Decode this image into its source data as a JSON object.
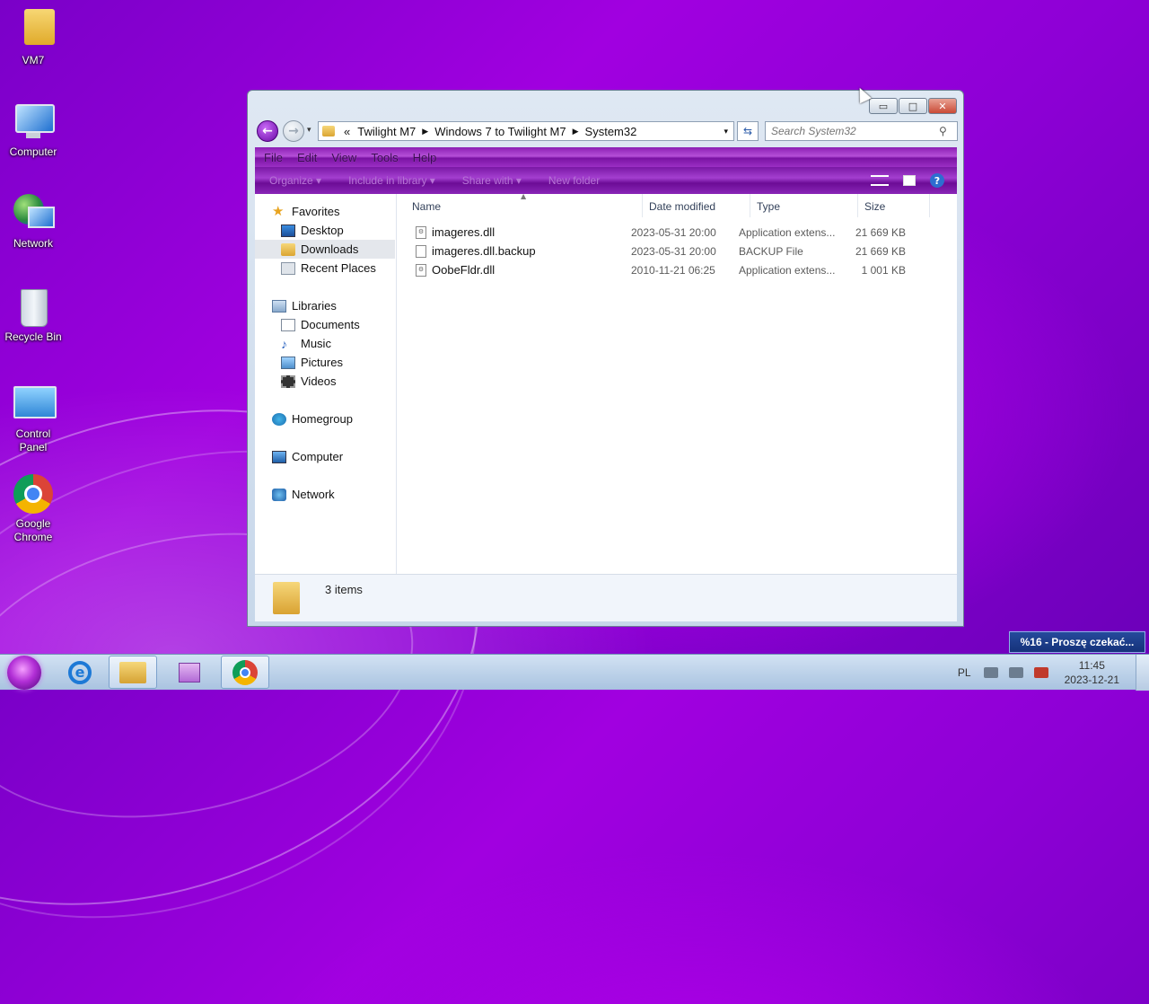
{
  "desktop": {
    "icons": [
      {
        "label": "VM7",
        "icon": "user-folder-icon"
      },
      {
        "label": "Computer",
        "icon": "computer-icon"
      },
      {
        "label": "Network",
        "icon": "network-icon"
      },
      {
        "label": "Recycle Bin",
        "icon": "recycle-bin-icon"
      },
      {
        "label": "Control Panel",
        "icon": "control-panel-icon"
      },
      {
        "label": "Google Chrome",
        "icon": "chrome-icon"
      }
    ]
  },
  "window": {
    "controls": {
      "minimize": "▭",
      "maximize": "□",
      "close": "✕"
    },
    "nav": {
      "back": "←",
      "forward": "→",
      "recent": "▾"
    },
    "address": {
      "overflow": "«",
      "crumbs": [
        "Twilight M7",
        "Windows 7 to Twilight M7",
        "System32"
      ],
      "separator": "▶",
      "dropdown": "▾"
    },
    "refresh": "⇆",
    "search": {
      "placeholder": "Search System32",
      "icon": "⚲"
    },
    "menu": [
      "File",
      "Edit",
      "View",
      "Tools",
      "Help"
    ],
    "commands": [
      "Organize ▾",
      "Include in library ▾",
      "Share with ▾",
      "New folder"
    ],
    "help": "?",
    "nav_pane": {
      "favorites": {
        "label": "Favorites",
        "items": [
          "Desktop",
          "Downloads",
          "Recent Places"
        ]
      },
      "libraries": {
        "label": "Libraries",
        "items": [
          "Documents",
          "Music",
          "Pictures",
          "Videos"
        ]
      },
      "homegroup": "Homegroup",
      "computer": "Computer",
      "network": "Network"
    },
    "columns": {
      "name": "Name",
      "date": "Date modified",
      "type": "Type",
      "size": "Size"
    },
    "files": [
      {
        "name": "imageres.dll",
        "date": "2023-05-31 20:00",
        "type": "Application extens...",
        "size": "21 669 KB"
      },
      {
        "name": "imageres.dll.backup",
        "date": "2023-05-31 20:00",
        "type": "BACKUP File",
        "size": "21 669 KB"
      },
      {
        "name": "OobeFldr.dll",
        "date": "2010-11-21 06:25",
        "type": "Application extens...",
        "size": "1 001 KB"
      }
    ],
    "status": {
      "items": "3 items"
    }
  },
  "notification": "%16 - Proszę czekać...",
  "taskbar": {
    "tray": {
      "language": "PL",
      "time": "11:45",
      "date": "2023-12-21"
    }
  },
  "colors": {
    "accent": "#a100e0",
    "menubar": "#9b2fc4"
  }
}
